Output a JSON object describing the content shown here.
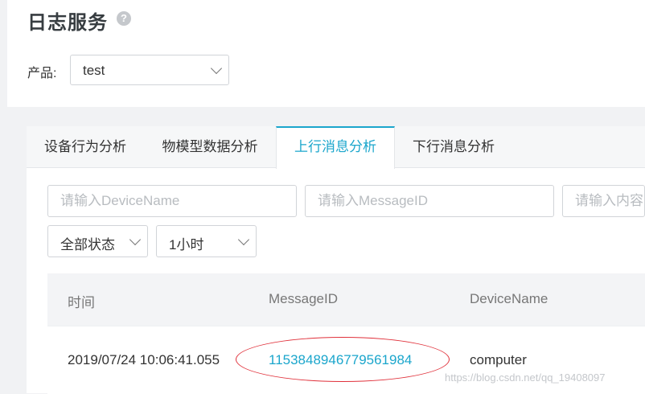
{
  "header": {
    "title": "日志服务",
    "help_glyph": "?"
  },
  "product": {
    "label": "产品:",
    "selected": "test"
  },
  "tabs": [
    {
      "label": "设备行为分析",
      "active": false
    },
    {
      "label": "物模型数据分析",
      "active": false
    },
    {
      "label": "上行消息分析",
      "active": true
    },
    {
      "label": "下行消息分析",
      "active": false
    }
  ],
  "filters": {
    "device_name_placeholder": "请输入DeviceName",
    "message_id_placeholder": "请输入MessageID",
    "content_placeholder": "请输入内容",
    "status_selected": "全部状态",
    "time_range_selected": "1小时"
  },
  "table": {
    "columns": [
      "时间",
      "MessageID",
      "DeviceName"
    ],
    "rows": [
      {
        "time": "2019/07/24 10:06:41.055",
        "message_id": "1153848946779561984",
        "device_name": "computer"
      }
    ]
  },
  "watermark": "https://blog.csdn.net/qq_19408097",
  "colors": {
    "accent": "#1ba6cc",
    "annotation_ellipse": "#e0303a",
    "background": "#f1f2f4"
  },
  "icons": {
    "help": "help-icon",
    "dropdown": "chevron-down-icon"
  }
}
